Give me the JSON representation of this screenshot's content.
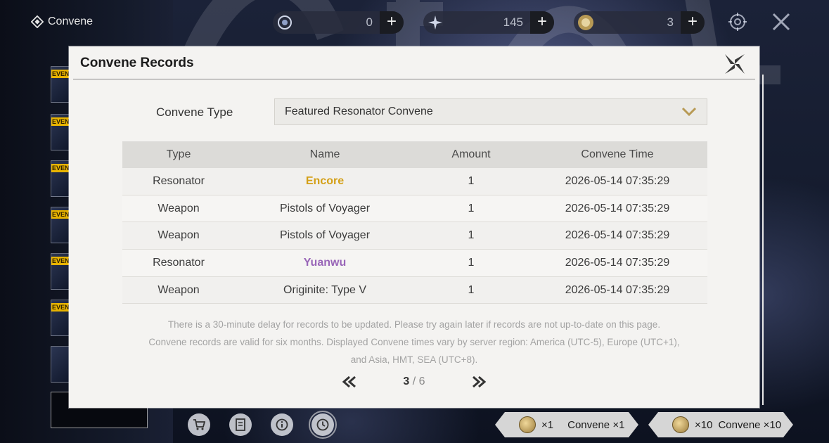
{
  "brand": {
    "label": "Convene"
  },
  "currencies": [
    {
      "icon": "lunite-icon",
      "value": "0"
    },
    {
      "icon": "astrite-icon",
      "value": "145"
    },
    {
      "icon": "forging-tide-icon",
      "value": "3"
    }
  ],
  "sidebar": {
    "tag": "EVENT"
  },
  "dialog": {
    "title": "Convene Records",
    "filter_label": "Convene Type",
    "filter_value": "Featured Resonator Convene",
    "columns": [
      "Type",
      "Name",
      "Amount",
      "Convene Time"
    ],
    "rows": [
      {
        "type": "Resonator",
        "name": "Encore",
        "amount": "1",
        "time": "2026-05-14 07:35:29",
        "color": "#d4a017"
      },
      {
        "type": "Weapon",
        "name": "Pistols of Voyager",
        "amount": "1",
        "time": "2026-05-14 07:35:29",
        "color": "#3c3c3c"
      },
      {
        "type": "Weapon",
        "name": "Pistols of Voyager",
        "amount": "1",
        "time": "2026-05-14 07:35:29",
        "color": "#3c3c3c"
      },
      {
        "type": "Resonator",
        "name": "Yuanwu",
        "amount": "1",
        "time": "2026-05-14 07:35:29",
        "color": "#9966b8"
      },
      {
        "type": "Weapon",
        "name": "Originite: Type V",
        "amount": "1",
        "time": "2026-05-14 07:35:29",
        "color": "#3c3c3c"
      }
    ],
    "note_lines": [
      "There is a 30-minute delay for records to be updated. Please try again later if records are not up-to-date on this page.",
      "Convene records are valid for six months. Displayed Convene times vary by server region: America (UTC-5), Europe (UTC+1),",
      "and Asia, HMT, SEA (UTC+8)."
    ],
    "pagination": {
      "current": "3",
      "separator": "/",
      "total": "6"
    }
  },
  "bottom_nav": [
    "cart-icon",
    "record-icon",
    "info-icon",
    "history-icon"
  ],
  "convene_buttons": {
    "single": {
      "count": "×1",
      "label": "Convene ×1"
    },
    "ten": {
      "count": "×10",
      "label": "Convene ×10"
    }
  },
  "colors": {
    "five_star": "#d4a017",
    "four_star": "#9966b8",
    "accent_gold": "#b89a55"
  }
}
